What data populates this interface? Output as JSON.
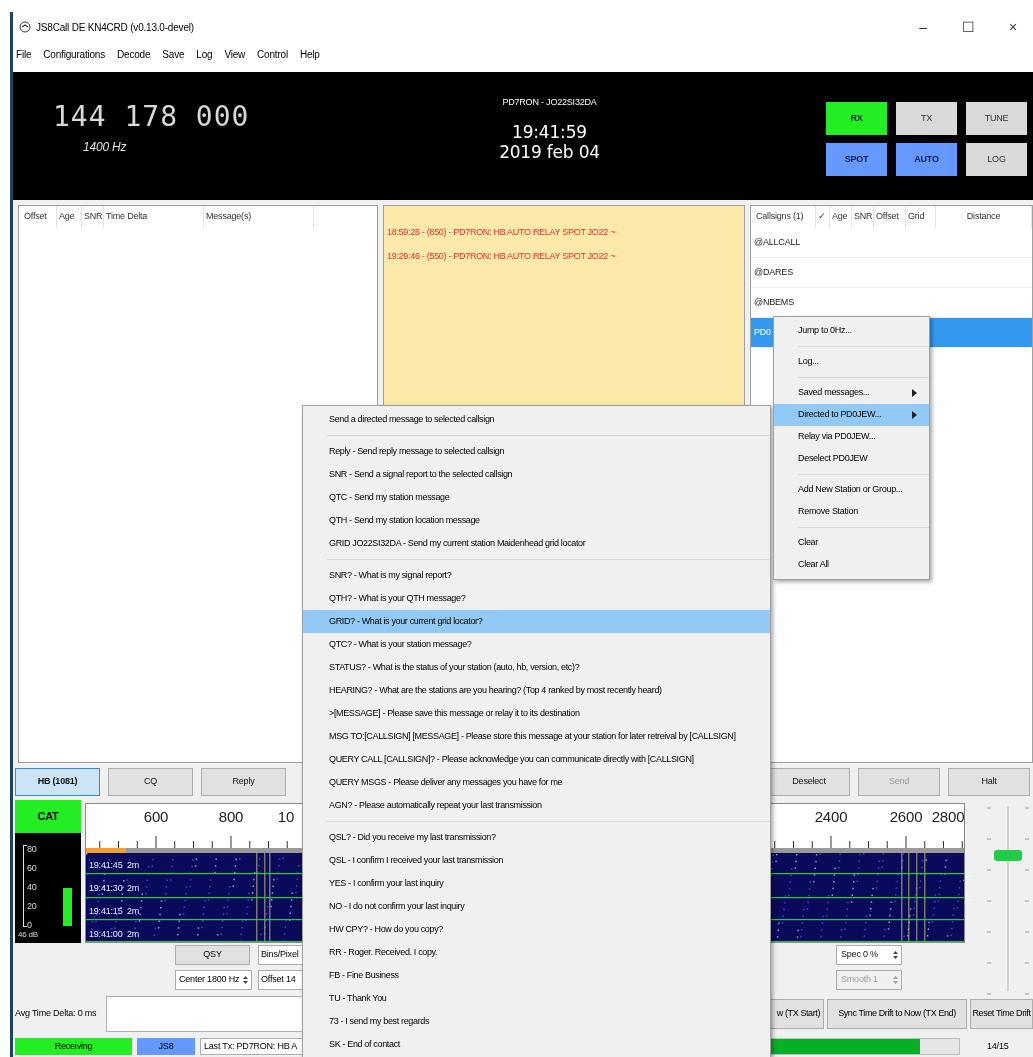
{
  "window": {
    "title": "JS8Call DE KN4CRD (v0.13.0-devel)",
    "controls": [
      "–",
      "☐",
      "×"
    ]
  },
  "menu_bar": [
    "File",
    "Configurations",
    "Decode",
    "Save",
    "Log",
    "View",
    "Control",
    "Help"
  ],
  "header": {
    "frequency": "144 178 000",
    "offset": "1400 Hz",
    "station": "PD7RON - JO22SI32DA",
    "time": "19:41:59",
    "date": "2019 feb 04",
    "buttons": [
      {
        "label": "RX",
        "on": true,
        "color": "#22ee22"
      },
      {
        "label": "TX",
        "on": false
      },
      {
        "label": "TUNE",
        "on": false
      },
      {
        "label": "SPOT",
        "on": true,
        "color": "#6699ff"
      },
      {
        "label": "AUTO",
        "on": true,
        "color": "#6699ff"
      },
      {
        "label": "LOG",
        "on": false
      }
    ]
  },
  "activity_table": {
    "columns": [
      "Offset",
      "Age",
      "SNR",
      "Time Delta",
      "Message(s)"
    ]
  },
  "band_activity": {
    "messages": [
      "18:59:26 - (850) - PD7RON: HB AUTO RELAY SPOT JO22 ~",
      "19:29:46 - (550) - PD7RON: HB AUTO RELAY SPOT JO22 ~"
    ]
  },
  "callsigns": {
    "columns": [
      "Callsigns (1)",
      "✓",
      "Age",
      "SNR",
      "Offset",
      "Grid",
      "Distance"
    ],
    "rows": [
      {
        "callsign": "@ALLCALL",
        "selected": false
      },
      {
        "callsign": "@DARES",
        "selected": false
      },
      {
        "callsign": "@NBEMS",
        "selected": false
      },
      {
        "callsign": "PD0",
        "selected": true
      }
    ]
  },
  "buttons": [
    {
      "label": "HB (1081)",
      "checked": true,
      "disabled": false
    },
    {
      "label": "CQ",
      "checked": false,
      "disabled": false
    },
    {
      "label": "Reply",
      "checked": false,
      "disabled": false
    },
    {
      "label": "Deselect",
      "checked": false,
      "disabled": false
    },
    {
      "label": "Send",
      "checked": false,
      "disabled": true
    },
    {
      "label": "Halt",
      "checked": false,
      "disabled": false
    }
  ],
  "waterfall": {
    "cat": "CAT",
    "meter_ticks": [
      "80",
      "60",
      "40",
      "20",
      "0"
    ],
    "meter": {
      "level": 0.46,
      "reading": "46 dB"
    },
    "ruler_labels": [
      "600",
      "800",
      "10",
      "2400",
      "2600",
      "2800"
    ],
    "time_labels": [
      "19:41:45  2m",
      "19:41:30  2m",
      "19:41:15  2m",
      "19:41:00  2m"
    ]
  },
  "controls": {
    "qsy": "QSY",
    "bins": "Bins/Pixel",
    "center": "Center 1800 Hz",
    "offset": "Offset 14",
    "spec": {
      "value": "Spec 0 %",
      "disabled": false
    },
    "smooth": {
      "value": "Smooth 1",
      "disabled": true
    }
  },
  "gain_slider": {
    "level": 0.76
  },
  "time_row": {
    "label": "Avg Time Delta: 0 ms",
    "buttons": [
      "w (TX Start)",
      "Sync Time Drift to Now (TX End)",
      "Reset Time Drift"
    ]
  },
  "status_bar": {
    "state": "Receiving",
    "mode": "JS8",
    "last_tx": "Last Tx: PD7RON: HB A",
    "progress": {
      "level": 0.93
    },
    "count": "14/15"
  },
  "context_menu": {
    "groups": [
      [
        {
          "label": "Send a directed message to selected callsign",
          "selected": false
        }
      ],
      [
        {
          "label": "Reply - Send reply message to selected callsign",
          "selected": false
        },
        {
          "label": "SNR - Send a signal report to the selected callsign",
          "selected": false
        },
        {
          "label": "QTC - Send my station message",
          "selected": false
        },
        {
          "label": "QTH - Send my station location message",
          "selected": false
        },
        {
          "label": "GRID JO22SI32DA - Send my current station Maidenhead grid locator",
          "selected": false
        }
      ],
      [
        {
          "label": "SNR? - What is my signal report?",
          "selected": false
        },
        {
          "label": "QTH? - What is your QTH message?",
          "selected": false
        },
        {
          "label": "GRID? - What is your current grid locator?",
          "selected": true
        },
        {
          "label": "QTC? - What is your station message?",
          "selected": false
        },
        {
          "label": "STATUS? - What is the status of your station (auto, hb, version, etc)?",
          "selected": false
        },
        {
          "label": "HEARING? - What are the stations are you hearing? (Top 4 ranked by most recently heard)",
          "selected": false
        },
        {
          "label": ">[MESSAGE] - Please save this message or relay it to its destination",
          "selected": false
        },
        {
          "label": "MSG TO:[CALLSIGN] [MESSAGE] - Please store this message at your station for later retreival by [CALLSIGN]",
          "selected": false
        },
        {
          "label": "QUERY CALL [CALLSIGN]? - Please acknowledge you can communicate directly with [CALLSIGN]",
          "selected": false
        },
        {
          "label": "QUERY MSGS - Please deliver any messages you have for me",
          "selected": false
        },
        {
          "label": "AGN? - Please automatically repeat your last transmission",
          "selected": false
        }
      ],
      [
        {
          "label": "QSL? - Did you receive my last transmission?",
          "selected": false
        },
        {
          "label": "QSL - I confirm I received your last transmission",
          "selected": false
        },
        {
          "label": "YES - I confirm your last inquiry",
          "selected": false
        },
        {
          "label": "NO - I do not confirm your last inquiry",
          "selected": false
        },
        {
          "label": "HW CPY? - How do you copy?",
          "selected": false
        },
        {
          "label": "RR - Roger. Received. I copy.",
          "selected": false
        },
        {
          "label": "FB - Fine Business",
          "selected": false
        },
        {
          "label": "TU - Thank You",
          "selected": false
        },
        {
          "label": "73 - I send my best regards",
          "selected": false
        },
        {
          "label": "SK - End of contact",
          "selected": false
        }
      ]
    ]
  },
  "station_menu": {
    "groups": [
      [
        {
          "label": "Jump to 0Hz...",
          "selected": false,
          "has_submenu": false
        }
      ],
      [
        {
          "label": "Log...",
          "selected": false,
          "has_submenu": false
        }
      ],
      [
        {
          "label": "Saved messages...",
          "selected": false,
          "has_submenu": true
        },
        {
          "label": "Directed to PD0JEW...",
          "selected": true,
          "has_submenu": true
        },
        {
          "label": "Relay via PD0JEW...",
          "selected": false,
          "has_submenu": false
        },
        {
          "label": "Deselect PD0JEW",
          "selected": false,
          "has_submenu": false
        }
      ],
      [
        {
          "label": "Add New Station or Group...",
          "selected": false,
          "has_submenu": false
        },
        {
          "label": "Remove Station",
          "selected": false,
          "has_submenu": false
        }
      ],
      [
        {
          "label": "Clear",
          "selected": false,
          "has_submenu": false
        },
        {
          "label": "Clear All",
          "selected": false,
          "has_submenu": false
        }
      ]
    ]
  }
}
